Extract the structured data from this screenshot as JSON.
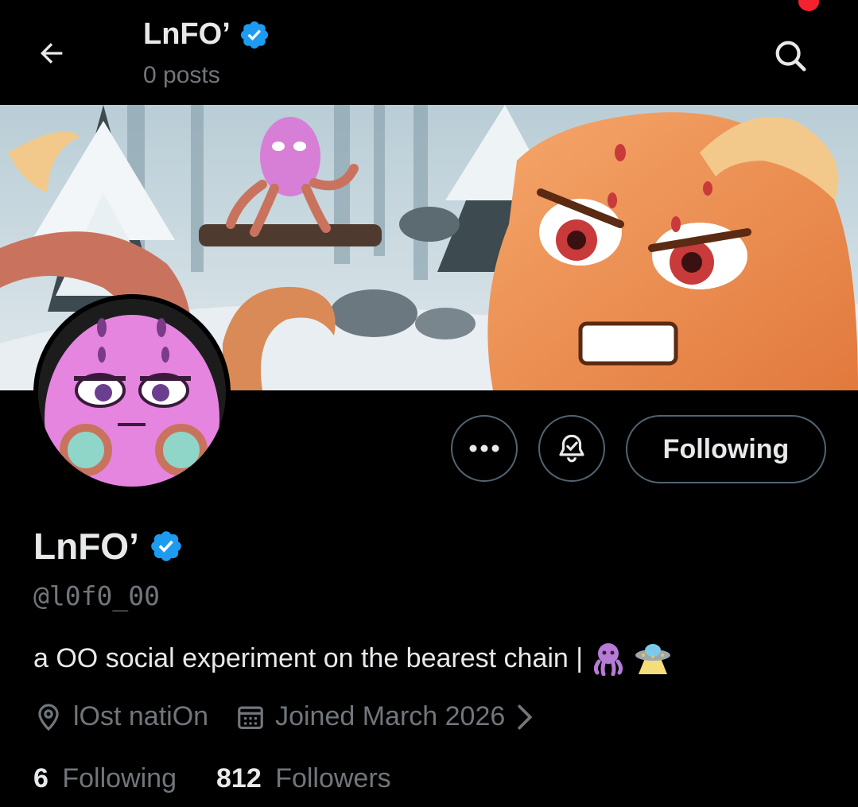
{
  "header": {
    "display_name": "LnFO’",
    "post_count": "0 posts"
  },
  "profile": {
    "display_name": "LnFO’",
    "handle": "@l0f0_00",
    "bio": "a OO social experiment on the bearest chain |",
    "location": "lOst natiOn",
    "joined": "Joined March 2026",
    "following_count": "6",
    "following_label": "Following",
    "followers_count": "812",
    "followers_label": "Followers"
  },
  "actions": {
    "following_button": "Following"
  },
  "icons": {
    "back": "arrow-left-icon",
    "search": "search-icon",
    "verified": "verified-badge-icon",
    "more": "more-dots-icon",
    "notify": "bell-check-icon",
    "location": "location-pin-icon",
    "calendar": "calendar-icon",
    "chevron": "chevron-right-icon"
  },
  "colors": {
    "background": "#000000",
    "text_primary": "#e7e9ea",
    "text_secondary": "#71767b",
    "verified_blue": "#1d9bf0",
    "border": "#536471"
  }
}
